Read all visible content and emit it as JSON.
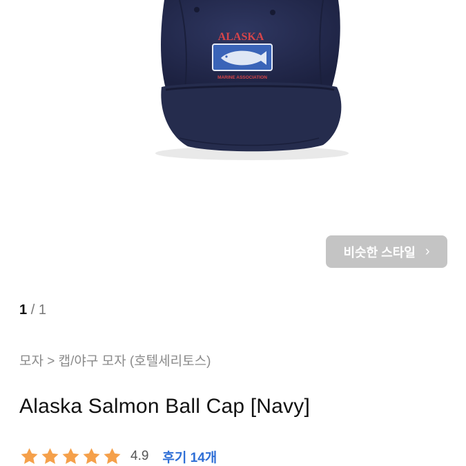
{
  "product_image": {
    "embroidery_top": "ALASKA",
    "embroidery_bottom": "MARINE ASSOCIATION",
    "cap_color": "#252c4d",
    "patch_color": "#3a64b8",
    "embroidery_red": "#d8454a"
  },
  "similar_button": {
    "label": "비슷한 스타일",
    "chevron_icon": "chevron-right-icon"
  },
  "pager": {
    "current": "1",
    "separator": "/",
    "total": "1"
  },
  "breadcrumb": {
    "category": "모자",
    "separator": ">",
    "subcategory": "캡/야구 모자 (호텔세리토스)"
  },
  "product": {
    "title": "Alaska Salmon Ball Cap [Navy]"
  },
  "rating": {
    "stars": 5,
    "star_color": "#f5a04a",
    "score": "4.9",
    "reviews_label": "후기 14개",
    "link_color": "#2f6fd6"
  }
}
